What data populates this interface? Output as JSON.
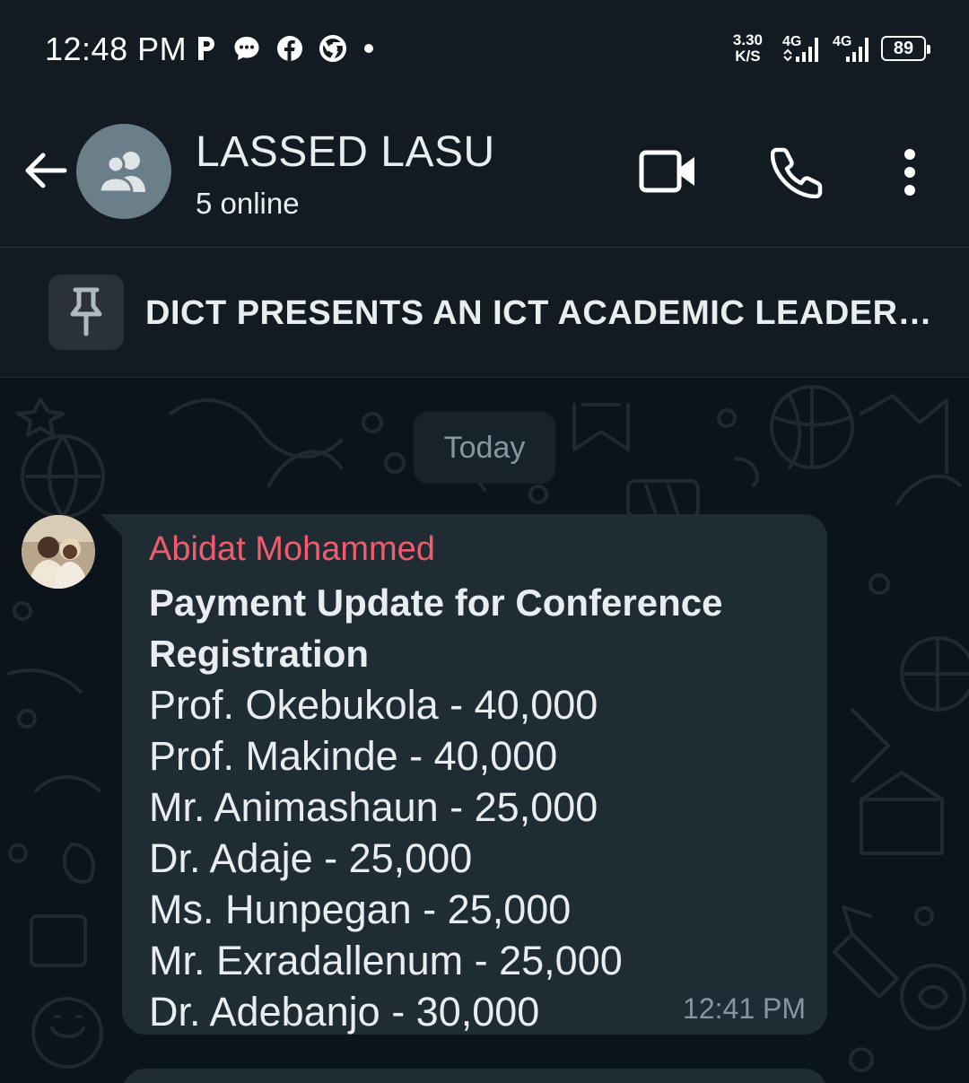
{
  "status_bar": {
    "time": "12:48 PM",
    "left_icons": [
      "parking-app-icon",
      "chat-bubble-icon",
      "facebook-icon",
      "chrome-icon",
      "dot-icon"
    ],
    "net_speed_value": "3.30",
    "net_speed_unit": "K/S",
    "signal_1_label": "4G",
    "signal_2_label": "4G",
    "battery": "89"
  },
  "header": {
    "title": "LASSED LASU",
    "subtitle": "5 online",
    "actions": [
      "video-call-icon",
      "voice-call-icon",
      "more-options-icon"
    ]
  },
  "pinned": {
    "text": "DICT PRESENTS AN ICT ACADEMIC LEADER…"
  },
  "chat": {
    "date_label": "Today",
    "message": {
      "sender": "Abidat Mohammed",
      "heading_line_1": "Payment Update for Conference",
      "heading_line_2": "Registration",
      "lines": [
        "Prof. Okebukola - 40,000",
        "Prof. Makinde - 40,000",
        "Mr. Animashaun - 25,000",
        "Dr. Adaje - 25,000",
        "Ms. Hunpegan - 25,000",
        "Mr. Exradallenum - 25,000",
        "Dr. Adebanjo - 30,000"
      ],
      "time": "12:41 PM"
    }
  },
  "colors": {
    "background": "#0b141a",
    "bar": "#111b21",
    "bubble": "#202c33",
    "sender_name": "#f15c6d",
    "muted_text": "#8696a0"
  }
}
